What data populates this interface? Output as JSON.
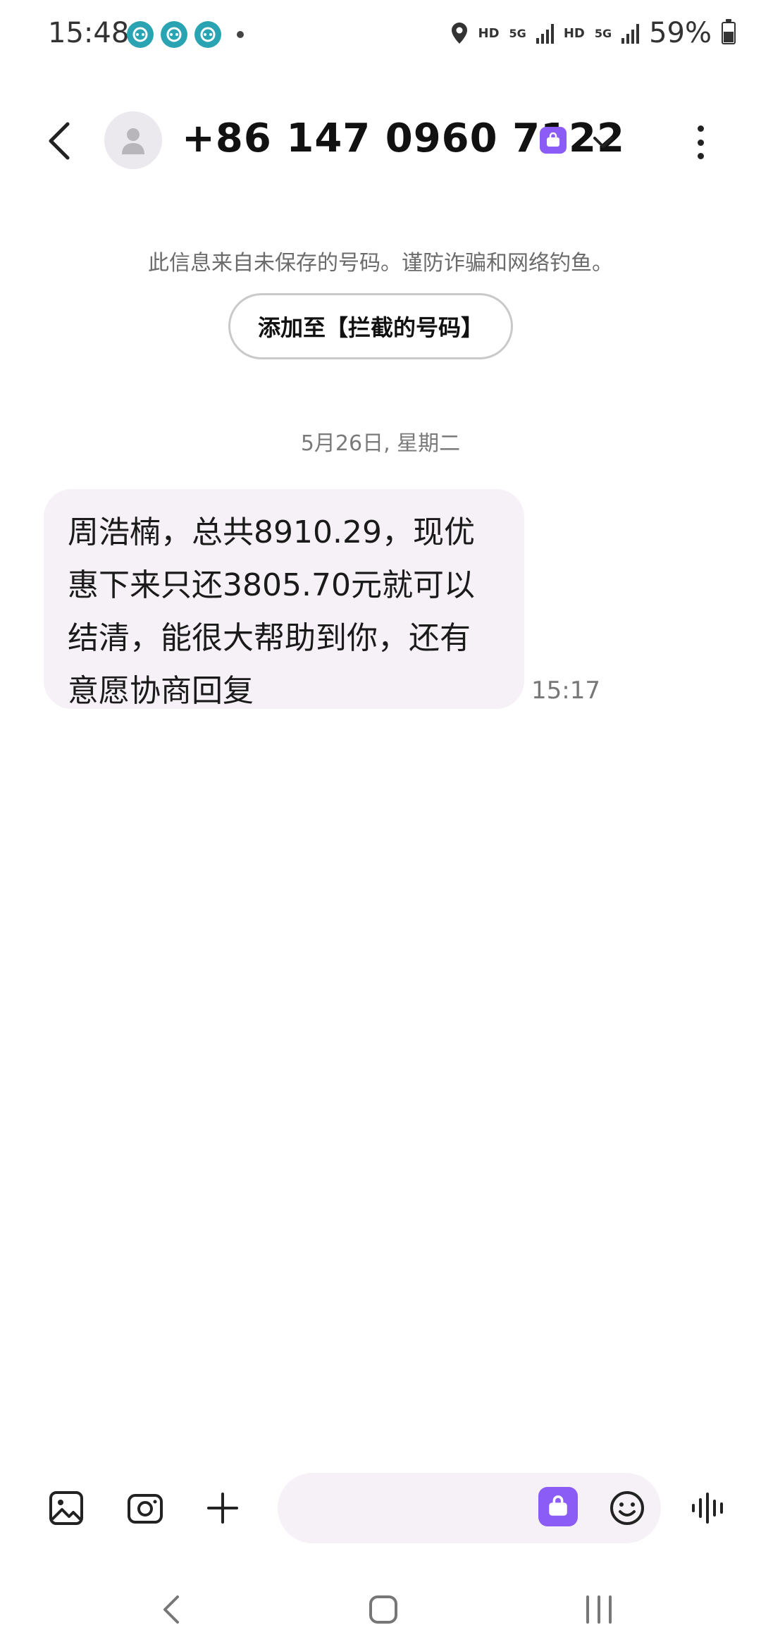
{
  "status_bar": {
    "time": "15:48",
    "hd1": "HD",
    "net1": "5G",
    "hd2": "HD",
    "net2": "5G",
    "battery": "59%",
    "app_icons": [
      "app-icon",
      "app-icon",
      "app-icon"
    ]
  },
  "header": {
    "title": "+86 147 0960 7122"
  },
  "notice": {
    "text": "此信息来自未保存的号码。谨防诈骗和网络钓鱼。",
    "block_button": "添加至【拦截的号码】"
  },
  "conversation": {
    "date": "5月26日, 星期二",
    "messages": [
      {
        "text": "周浩楠，总共8910.29，现优惠下来只还3805.70元就可以结清，能很大帮助到你，还有意愿协商回复",
        "time": "15:17"
      }
    ]
  },
  "composer": {
    "placeholder": ""
  },
  "colors": {
    "accent": "#8b5cf6",
    "bubble": "#f6f1f6",
    "status_app": "#2aa3b3"
  }
}
